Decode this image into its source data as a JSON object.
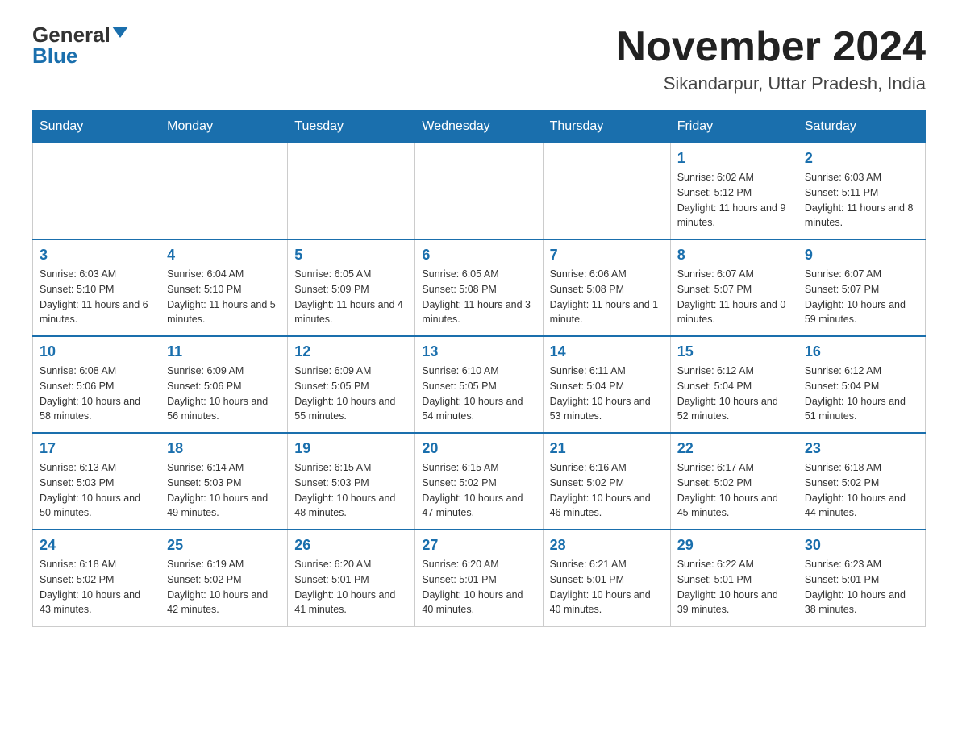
{
  "logo": {
    "general": "General",
    "blue": "Blue"
  },
  "header": {
    "title": "November 2024",
    "subtitle": "Sikandarpur, Uttar Pradesh, India"
  },
  "weekdays": [
    "Sunday",
    "Monday",
    "Tuesday",
    "Wednesday",
    "Thursday",
    "Friday",
    "Saturday"
  ],
  "weeks": [
    [
      {
        "day": "",
        "info": ""
      },
      {
        "day": "",
        "info": ""
      },
      {
        "day": "",
        "info": ""
      },
      {
        "day": "",
        "info": ""
      },
      {
        "day": "",
        "info": ""
      },
      {
        "day": "1",
        "info": "Sunrise: 6:02 AM\nSunset: 5:12 PM\nDaylight: 11 hours and 9 minutes."
      },
      {
        "day": "2",
        "info": "Sunrise: 6:03 AM\nSunset: 5:11 PM\nDaylight: 11 hours and 8 minutes."
      }
    ],
    [
      {
        "day": "3",
        "info": "Sunrise: 6:03 AM\nSunset: 5:10 PM\nDaylight: 11 hours and 6 minutes."
      },
      {
        "day": "4",
        "info": "Sunrise: 6:04 AM\nSunset: 5:10 PM\nDaylight: 11 hours and 5 minutes."
      },
      {
        "day": "5",
        "info": "Sunrise: 6:05 AM\nSunset: 5:09 PM\nDaylight: 11 hours and 4 minutes."
      },
      {
        "day": "6",
        "info": "Sunrise: 6:05 AM\nSunset: 5:08 PM\nDaylight: 11 hours and 3 minutes."
      },
      {
        "day": "7",
        "info": "Sunrise: 6:06 AM\nSunset: 5:08 PM\nDaylight: 11 hours and 1 minute."
      },
      {
        "day": "8",
        "info": "Sunrise: 6:07 AM\nSunset: 5:07 PM\nDaylight: 11 hours and 0 minutes."
      },
      {
        "day": "9",
        "info": "Sunrise: 6:07 AM\nSunset: 5:07 PM\nDaylight: 10 hours and 59 minutes."
      }
    ],
    [
      {
        "day": "10",
        "info": "Sunrise: 6:08 AM\nSunset: 5:06 PM\nDaylight: 10 hours and 58 minutes."
      },
      {
        "day": "11",
        "info": "Sunrise: 6:09 AM\nSunset: 5:06 PM\nDaylight: 10 hours and 56 minutes."
      },
      {
        "day": "12",
        "info": "Sunrise: 6:09 AM\nSunset: 5:05 PM\nDaylight: 10 hours and 55 minutes."
      },
      {
        "day": "13",
        "info": "Sunrise: 6:10 AM\nSunset: 5:05 PM\nDaylight: 10 hours and 54 minutes."
      },
      {
        "day": "14",
        "info": "Sunrise: 6:11 AM\nSunset: 5:04 PM\nDaylight: 10 hours and 53 minutes."
      },
      {
        "day": "15",
        "info": "Sunrise: 6:12 AM\nSunset: 5:04 PM\nDaylight: 10 hours and 52 minutes."
      },
      {
        "day": "16",
        "info": "Sunrise: 6:12 AM\nSunset: 5:04 PM\nDaylight: 10 hours and 51 minutes."
      }
    ],
    [
      {
        "day": "17",
        "info": "Sunrise: 6:13 AM\nSunset: 5:03 PM\nDaylight: 10 hours and 50 minutes."
      },
      {
        "day": "18",
        "info": "Sunrise: 6:14 AM\nSunset: 5:03 PM\nDaylight: 10 hours and 49 minutes."
      },
      {
        "day": "19",
        "info": "Sunrise: 6:15 AM\nSunset: 5:03 PM\nDaylight: 10 hours and 48 minutes."
      },
      {
        "day": "20",
        "info": "Sunrise: 6:15 AM\nSunset: 5:02 PM\nDaylight: 10 hours and 47 minutes."
      },
      {
        "day": "21",
        "info": "Sunrise: 6:16 AM\nSunset: 5:02 PM\nDaylight: 10 hours and 46 minutes."
      },
      {
        "day": "22",
        "info": "Sunrise: 6:17 AM\nSunset: 5:02 PM\nDaylight: 10 hours and 45 minutes."
      },
      {
        "day": "23",
        "info": "Sunrise: 6:18 AM\nSunset: 5:02 PM\nDaylight: 10 hours and 44 minutes."
      }
    ],
    [
      {
        "day": "24",
        "info": "Sunrise: 6:18 AM\nSunset: 5:02 PM\nDaylight: 10 hours and 43 minutes."
      },
      {
        "day": "25",
        "info": "Sunrise: 6:19 AM\nSunset: 5:02 PM\nDaylight: 10 hours and 42 minutes."
      },
      {
        "day": "26",
        "info": "Sunrise: 6:20 AM\nSunset: 5:01 PM\nDaylight: 10 hours and 41 minutes."
      },
      {
        "day": "27",
        "info": "Sunrise: 6:20 AM\nSunset: 5:01 PM\nDaylight: 10 hours and 40 minutes."
      },
      {
        "day": "28",
        "info": "Sunrise: 6:21 AM\nSunset: 5:01 PM\nDaylight: 10 hours and 40 minutes."
      },
      {
        "day": "29",
        "info": "Sunrise: 6:22 AM\nSunset: 5:01 PM\nDaylight: 10 hours and 39 minutes."
      },
      {
        "day": "30",
        "info": "Sunrise: 6:23 AM\nSunset: 5:01 PM\nDaylight: 10 hours and 38 minutes."
      }
    ]
  ]
}
